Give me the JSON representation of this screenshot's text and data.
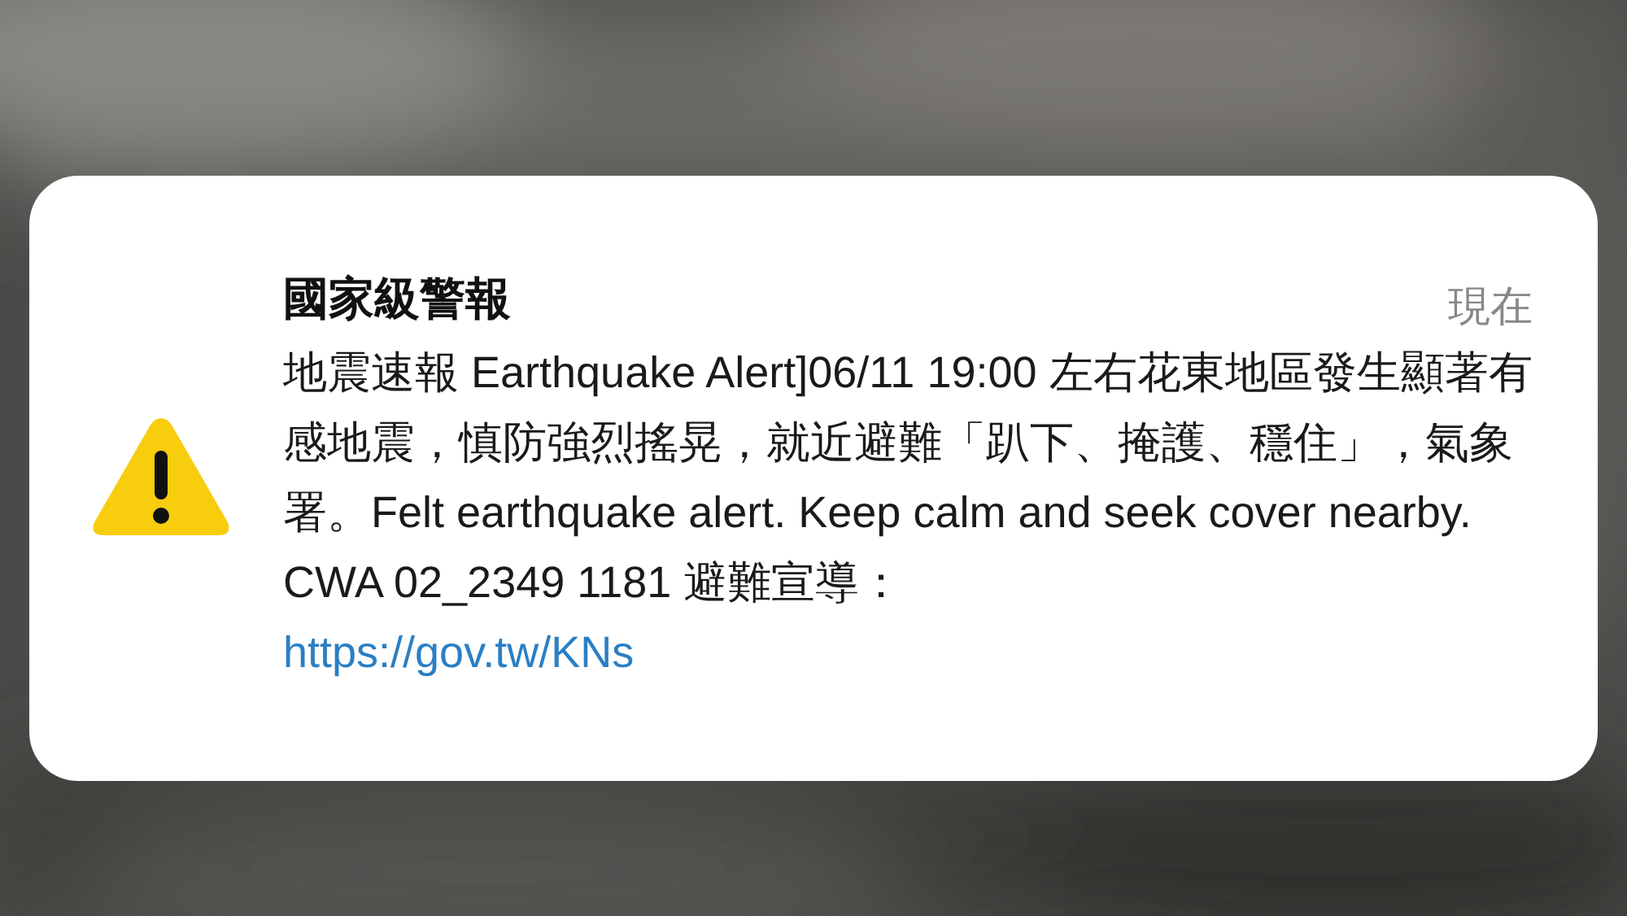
{
  "notification": {
    "title": "國家級警報",
    "time": "現在",
    "body": "地震速報 Earthquake Alert]06/11 19:00 左右花東地區發生顯著有感地震，慎防強烈搖晃，就近避難「趴下、掩護、穩住」，氣象署。Felt earthquake alert. Keep calm and seek cover nearby. CWA 02_2349 1181 避難宣導：",
    "link": "https://gov.tw/KNs"
  }
}
